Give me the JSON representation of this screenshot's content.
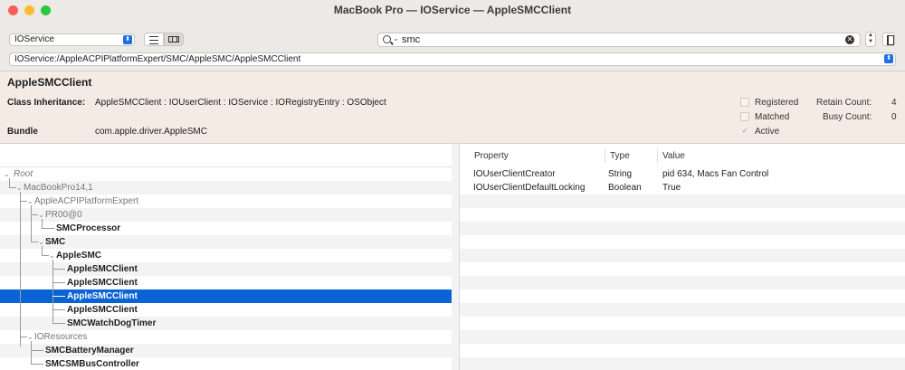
{
  "window": {
    "title": "MacBook Pro — IOService — AppleSMCClient"
  },
  "toolbar": {
    "plane_popup": "IOService",
    "search_value": "smc",
    "path": "IOService:/AppleACPIPlatformExpert/SMC/AppleSMC/AppleSMCClient"
  },
  "info": {
    "class_name": "AppleSMCClient",
    "inheritance_label": "Class Inheritance:",
    "inheritance_value": "AppleSMCClient : IOUserClient : IOService : IORegistryEntry : OSObject",
    "bundle_label": "Bundle",
    "bundle_value": "com.apple.driver.AppleSMC",
    "registered_label": "Registered",
    "matched_label": "Matched",
    "active_label": "Active",
    "retain_label": "Retain Count:",
    "retain_value": "4",
    "busy_label": "Busy Count:",
    "busy_value": "0"
  },
  "tree": [
    {
      "label": "Root",
      "style": "root"
    },
    {
      "label": "MacBookPro14,1",
      "style": "gray"
    },
    {
      "label": "AppleACPIPlatformExpert",
      "style": "gray"
    },
    {
      "label": "PR00@0",
      "style": "gray"
    },
    {
      "label": "SMCProcessor",
      "style": "bold"
    },
    {
      "label": "SMC",
      "style": "bold"
    },
    {
      "label": "AppleSMC",
      "style": "bold"
    },
    {
      "label": "AppleSMCClient",
      "style": "bold"
    },
    {
      "label": "AppleSMCClient",
      "style": "bold"
    },
    {
      "label": "AppleSMCClient",
      "style": "bold"
    },
    {
      "label": "AppleSMCClient",
      "style": "bold"
    },
    {
      "label": "SMCWatchDogTimer",
      "style": "bold"
    },
    {
      "label": "IOResources",
      "style": "gray"
    },
    {
      "label": "SMCBatteryManager",
      "style": "bold"
    },
    {
      "label": "SMCSMBusController",
      "style": "bold"
    }
  ],
  "properties": {
    "headers": {
      "property": "Property",
      "type": "Type",
      "value": "Value"
    },
    "rows": [
      {
        "property": "IOUserClientCreator",
        "type": "String",
        "value": "pid 634, Macs Fan Control"
      },
      {
        "property": "IOUserClientDefaultLocking",
        "type": "Boolean",
        "value": "True"
      }
    ]
  },
  "colors": {
    "selection": "#0a63d4",
    "info_bg": "#f4ebe5",
    "toolbar_bg": "#ece9e6"
  }
}
